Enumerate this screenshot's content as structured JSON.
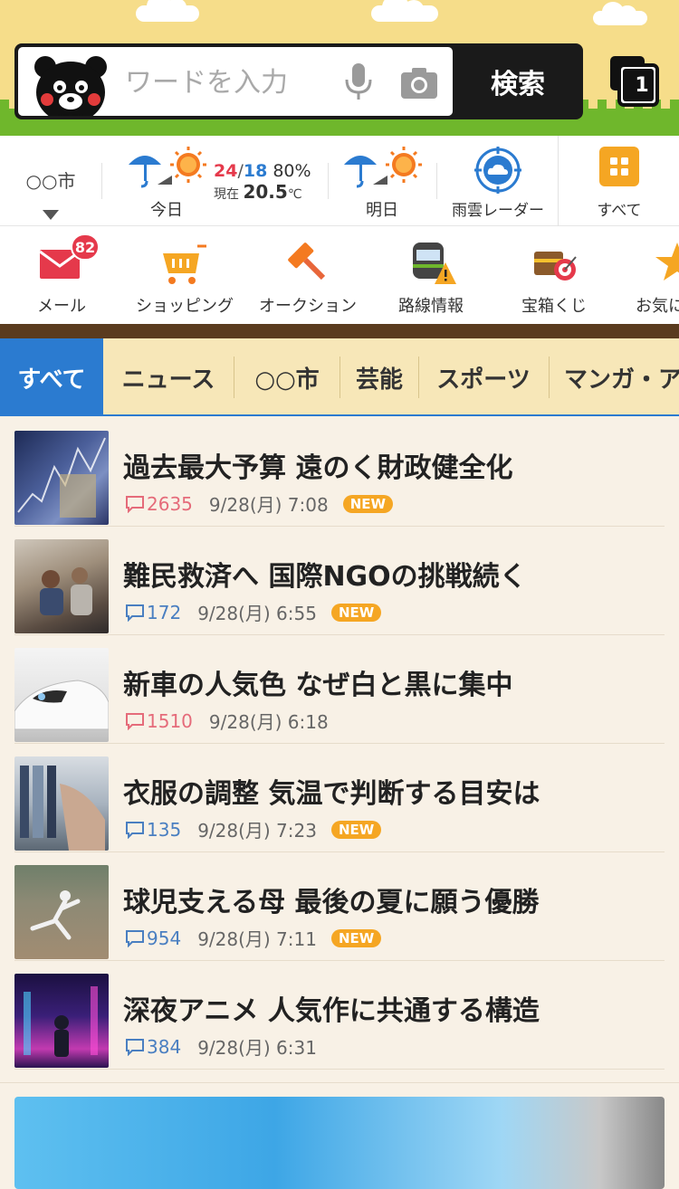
{
  "search": {
    "placeholder": "ワードを入力",
    "button_label": "検索",
    "tab_count": "1"
  },
  "weather": {
    "city": "○○市",
    "today_label": "今日",
    "high": "24",
    "separator": "/",
    "low": "18",
    "precip": "80%",
    "now_label": "現在",
    "now_temp": "20.5",
    "unit": "℃",
    "tomorrow_label": "明日",
    "radar_label": "雨雲レーダー",
    "all_label": "すべて"
  },
  "services": {
    "mail": "メール",
    "mail_badge": "82",
    "shopping": "ショッピング",
    "auction": "オークション",
    "transit": "路線情報",
    "lottery": "宝箱くじ",
    "favorites": "お気に"
  },
  "categories": {
    "all": "すべて",
    "news": "ニュース",
    "city": "○○市",
    "entertainment": "芸能",
    "sports": "スポーツ",
    "manga": "マンガ・ア"
  },
  "news": [
    {
      "title": "過去最大予算 遠のく財政健全化",
      "comments": "2635",
      "date": "9/28(月) 7:08",
      "new": "NEW"
    },
    {
      "title": "難民救済へ 国際NGOの挑戦続く",
      "comments": "172",
      "date": "9/28(月) 6:55",
      "new": "NEW"
    },
    {
      "title": "新車の人気色 なぜ白と黒に集中",
      "comments": "1510",
      "date": "9/28(月) 6:18"
    },
    {
      "title": "衣服の調整 気温で判断する目安は",
      "comments": "135",
      "date": "9/28(月) 7:23",
      "new": "NEW"
    },
    {
      "title": "球児支える母 最後の夏に願う優勝",
      "comments": "954",
      "date": "9/28(月) 7:11",
      "new": "NEW"
    },
    {
      "title": "深夜アニメ 人気作に共通する構造",
      "comments": "384",
      "date": "9/28(月) 6:31"
    }
  ],
  "colors": {
    "accent_blue": "#2b7bd0",
    "hot_comment": "#e56b7a",
    "new_badge": "#f5a623",
    "header_bg": "#f6dd8a",
    "grass": "#6fb72c"
  }
}
